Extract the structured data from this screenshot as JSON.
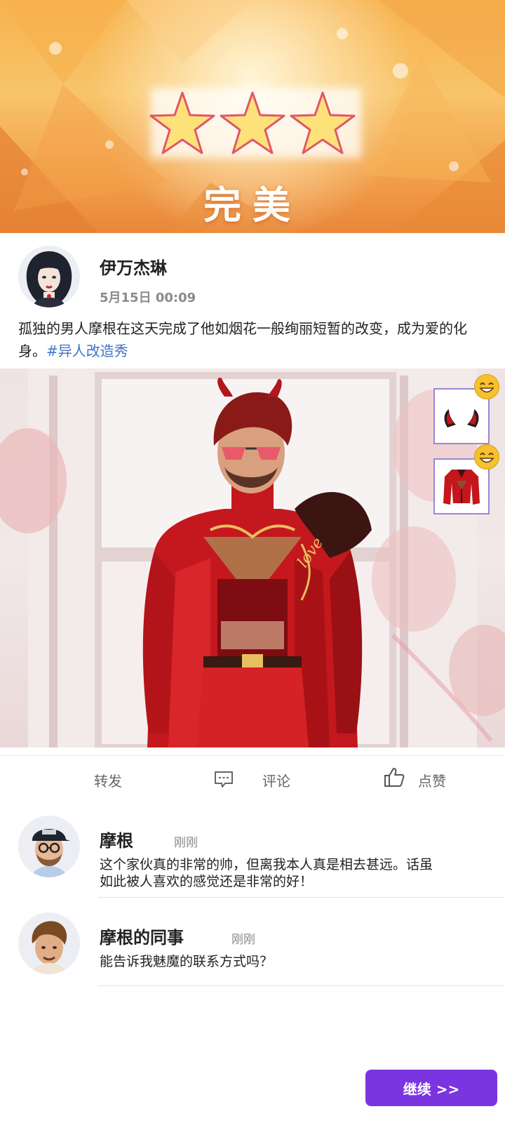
{
  "banner": {
    "stars_earned": 3,
    "stars_total": 3,
    "rating_label": "完美"
  },
  "post": {
    "author": "伊万杰琳",
    "timestamp": "5月15日 00:09",
    "text": "孤独的男人摩根在这天完成了他如烟花一般绚丽短暂的改变，成为爱的化身。",
    "hashtag": "#异人改造秀",
    "image_items": [
      {
        "name": "devil-horns",
        "reaction": "smiley"
      },
      {
        "name": "red-jacket",
        "reaction": "smiley"
      }
    ],
    "badge_text": "love"
  },
  "actions": {
    "share": "转发",
    "comment": "评论",
    "like": "点赞"
  },
  "comments": [
    {
      "author": "摩根",
      "time": "刚刚",
      "text_line1": "这个家伙真的非常的帅，但离我本人真是相去甚远。话虽",
      "text_line2": "如此被人喜欢的感觉还是非常的好！"
    },
    {
      "author": "摩根的同事",
      "time": "刚刚",
      "text_line1": "能告诉我魅魔的联系方式吗？",
      "text_line2": ""
    }
  ],
  "continue_label": "继续 >>",
  "colors": {
    "accent": "#7b35e0",
    "hashtag": "#3f72c8",
    "star_fill": "#fde27a",
    "star_outline": "#e2566a"
  }
}
